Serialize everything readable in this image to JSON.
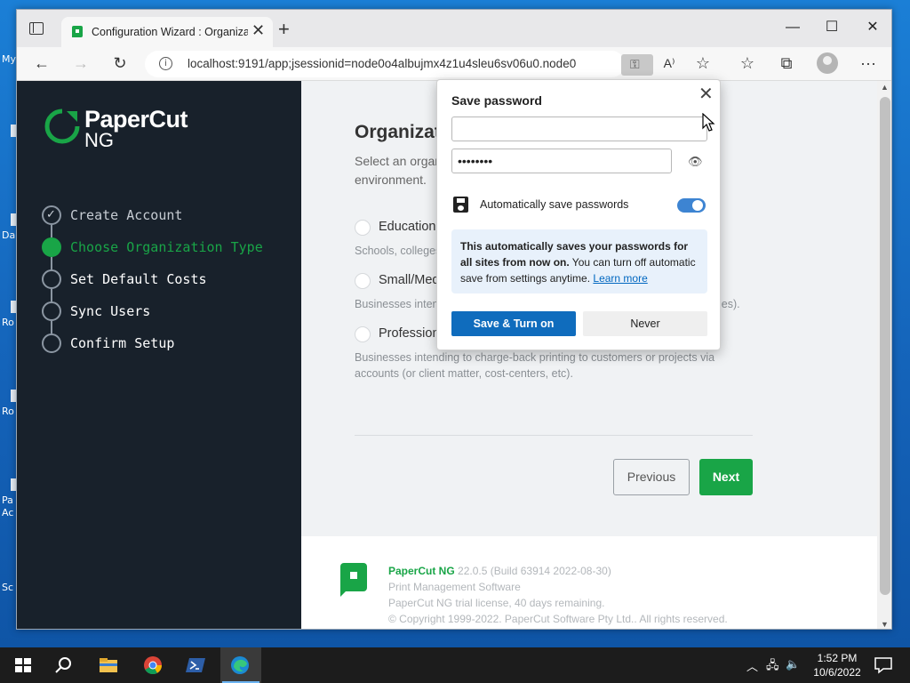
{
  "desktop": {
    "labels": [
      "My",
      "Da",
      "Ro",
      "Ro",
      "Pa",
      "Ac",
      "Sc"
    ]
  },
  "browser": {
    "tab_title": "Configuration Wizard : Organizat",
    "url": "localhost:9191/app;jsessionid=node0o4albujmx4z1u4sleu6sv06u0.node0",
    "controls": {
      "minimize": "—",
      "maximize": "☐",
      "close": "✕",
      "new_tab": "+",
      "back": "←",
      "forward": "→",
      "refresh": "↻",
      "read_aloud": "A⁾",
      "favorites_add": "☆",
      "favorites": "☆",
      "collections": "⧉",
      "menu": "···"
    }
  },
  "sidebar": {
    "logo_name": "PaperCut",
    "logo_sub": "NG",
    "steps": [
      {
        "label": "Create Account",
        "state": "done"
      },
      {
        "label": "Choose Organization Type",
        "state": "active"
      },
      {
        "label": "Set Default Costs",
        "state": "todo"
      },
      {
        "label": "Sync Users",
        "state": "todo"
      },
      {
        "label": "Confirm Setup",
        "state": "todo"
      }
    ]
  },
  "main": {
    "title": "Organizat",
    "lead_line1": "Select an organ",
    "lead_line2": "environment.",
    "options": [
      {
        "title": "Education",
        "desc": "Schools, colleges"
      },
      {
        "title": "Small/Med",
        "desc_left": "Businesses inten",
        "desc_right": "ies)."
      },
      {
        "title": "Profession",
        "desc": "Businesses intending to charge-back printing to customers or projects via accounts (or client matter, cost-centers, etc)."
      }
    ],
    "previous_label": "Previous",
    "next_label": "Next"
  },
  "footer": {
    "product": "PaperCut NG",
    "version": " 22.0.5 (Build 63914 2022-08-30)",
    "tagline": "Print Management Software",
    "license": "PaperCut NG trial license, 40 days remaining.",
    "copyright": "© Copyright 1999-2022. PaperCut Software Pty Ltd.. All rights reserved."
  },
  "popup": {
    "title": "Save password",
    "username_value": "",
    "password_masked": "••••••••",
    "auto_save_label": "Automatically save passwords",
    "auto_save_on": true,
    "info_bold": "This automatically saves your passwords for all sites from now on.",
    "info_rest": " You can turn off automatic save from settings anytime. ",
    "learn_more": "Learn more",
    "save_label": "Save & Turn on",
    "never_label": "Never"
  },
  "taskbar": {
    "time": "1:52 PM",
    "date": "10/6/2022"
  },
  "colors": {
    "brand_green": "#19a547",
    "edge_blue": "#0f6cbd",
    "sidebar_bg": "#18212b"
  }
}
